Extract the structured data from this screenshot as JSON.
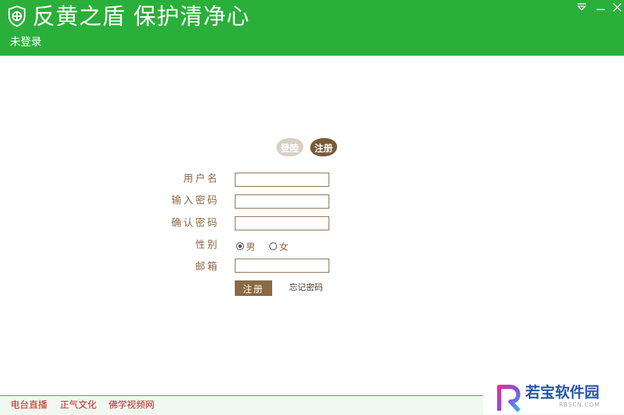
{
  "header": {
    "title": "反黄之盾  保护清净心",
    "login_status": "未登录"
  },
  "window_controls": [
    "menu-icon",
    "minimize-icon",
    "close-icon"
  ],
  "auth_tabs": {
    "login": "登陸",
    "register": "注册",
    "active": "register"
  },
  "form": {
    "username_label": "用户名",
    "password_label": "输入密码",
    "confirm_label": "确认密码",
    "gender_label": "性别",
    "gender_options": [
      "男",
      "女"
    ],
    "gender_selected": "男",
    "email_label": "邮箱",
    "username_value": "",
    "password_value": "",
    "confirm_value": "",
    "email_value": "",
    "submit_label": "注册",
    "forgot_label": "忘记密码"
  },
  "footer": {
    "links": [
      "电台直播",
      "正气文化",
      "佛学视频网"
    ]
  },
  "watermark": {
    "text": "若宝软件园",
    "sub": "RBSCN.COM"
  },
  "colors": {
    "header_green": "#2ab03a",
    "label_brown": "#8b6a45",
    "footer_link_red": "#c0281f"
  }
}
